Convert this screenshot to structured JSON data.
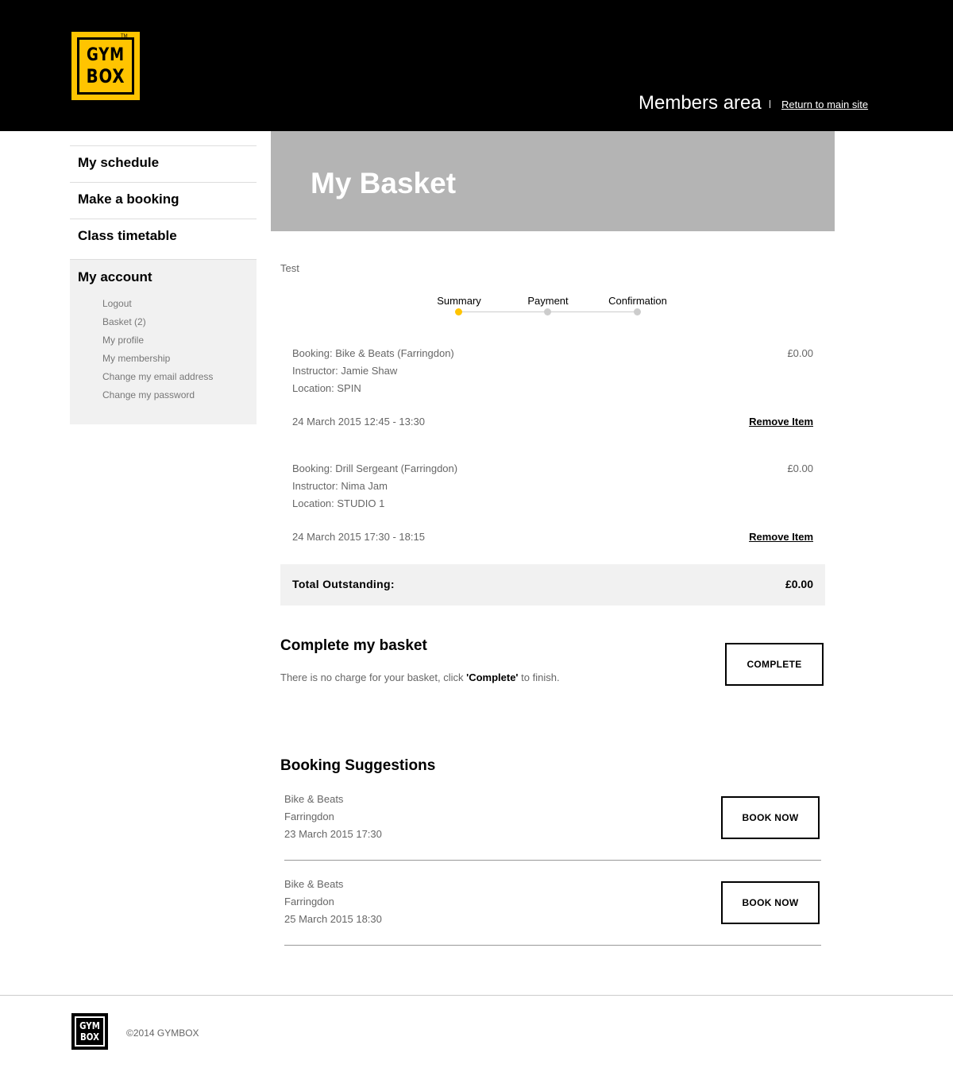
{
  "header": {
    "logo_line1": "GYM",
    "logo_line2": "BOX",
    "logo_tm": "TM",
    "members_area": "Members area",
    "return_link": "Return to main site"
  },
  "sidebar": {
    "nav": [
      {
        "label": "My schedule"
      },
      {
        "label": "Make a booking"
      },
      {
        "label": "Class timetable"
      }
    ],
    "account": {
      "title": "My account",
      "links": [
        {
          "label": "Logout"
        },
        {
          "label": "Basket (2)"
        },
        {
          "label": "My profile"
        },
        {
          "label": "My membership"
        },
        {
          "label": "Change my email address"
        },
        {
          "label": "Change my password"
        }
      ]
    }
  },
  "main": {
    "title": "My Basket",
    "user_label": "Test",
    "steps": [
      {
        "label": "Summary",
        "active": true
      },
      {
        "label": "Payment",
        "active": false
      },
      {
        "label": "Confirmation",
        "active": false
      }
    ],
    "basket_items": [
      {
        "booking": "Booking: Bike & Beats (Farringdon)",
        "instructor": "Instructor: Jamie Shaw",
        "location": "Location: SPIN",
        "datetime": "24 March 2015 12:45 - 13:30",
        "price": "£0.00",
        "remove_label": "Remove Item"
      },
      {
        "booking": "Booking: Drill Sergeant (Farringdon)",
        "instructor": "Instructor: Nima Jam",
        "location": "Location: STUDIO 1",
        "datetime": "24 March 2015 17:30 - 18:15",
        "price": "£0.00",
        "remove_label": "Remove Item"
      }
    ],
    "total": {
      "label": "Total Outstanding:",
      "value": "£0.00"
    },
    "complete": {
      "title": "Complete my basket",
      "text_before": "There is no charge for your basket, click ",
      "text_bold": "'Complete'",
      "text_after": " to finish.",
      "button_label": "COMPLETE"
    },
    "suggestions": {
      "title": "Booking Suggestions",
      "items": [
        {
          "class_name": "Bike & Beats",
          "club": "Farringdon",
          "datetime": "23 March 2015 17:30",
          "button_label": "BOOK NOW"
        },
        {
          "class_name": "Bike & Beats",
          "club": "Farringdon",
          "datetime": "25 March 2015 18:30",
          "button_label": "BOOK NOW"
        }
      ]
    }
  },
  "footer": {
    "logo_line1": "GYM",
    "logo_line2": "BOX",
    "copyright": "©2014 GYMBOX"
  },
  "colors": {
    "brand_yellow": "#ffc400",
    "header_bg": "#000000",
    "banner_bg": "#b4b4b4",
    "panel_bg": "#f1f1f1"
  }
}
